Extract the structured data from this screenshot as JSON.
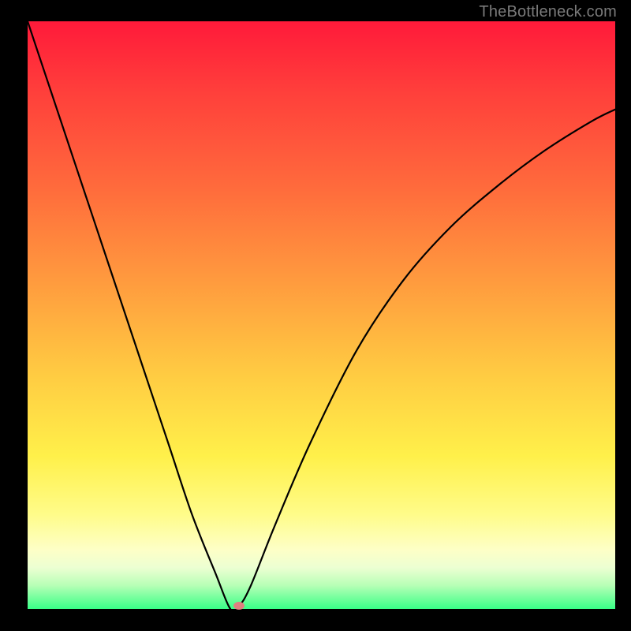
{
  "watermark": "TheBottleneck.com",
  "chart_data": {
    "type": "line",
    "title": "",
    "xlabel": "",
    "ylabel": "",
    "xlim": [
      0,
      100
    ],
    "ylim": [
      0,
      100
    ],
    "grid": false,
    "legend": false,
    "series": [
      {
        "name": "bottleneck-curve",
        "x": [
          0,
          4,
          8,
          12,
          16,
          20,
          24,
          28,
          32,
          34.5,
          36,
          38,
          42,
          48,
          56,
          64,
          72,
          80,
          88,
          96,
          100
        ],
        "y": [
          100,
          88,
          76,
          64,
          52,
          40,
          28,
          16,
          6,
          0,
          0.5,
          4,
          14,
          28,
          44,
          56,
          65,
          72,
          78,
          83,
          85
        ]
      }
    ],
    "marker": {
      "x": 36,
      "y": 0.5,
      "color": "#e08080"
    },
    "gradient_stops": [
      {
        "pos": 0,
        "color": "#ff1a3a"
      },
      {
        "pos": 12,
        "color": "#ff3f3b"
      },
      {
        "pos": 28,
        "color": "#ff6a3c"
      },
      {
        "pos": 44,
        "color": "#ff9a3e"
      },
      {
        "pos": 60,
        "color": "#ffcb42"
      },
      {
        "pos": 74,
        "color": "#fff04a"
      },
      {
        "pos": 84,
        "color": "#fffc8a"
      },
      {
        "pos": 90,
        "color": "#fdffc7"
      },
      {
        "pos": 93,
        "color": "#ecffd2"
      },
      {
        "pos": 96,
        "color": "#b7ffb6"
      },
      {
        "pos": 100,
        "color": "#39ff87"
      }
    ]
  }
}
